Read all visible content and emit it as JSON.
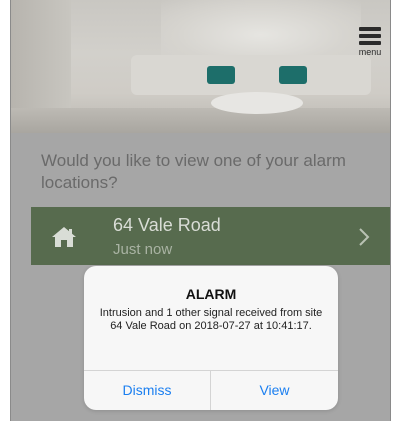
{
  "menu": {
    "label": "menu",
    "icon": "hamburger-menu-icon"
  },
  "prompt": {
    "text": "Would you like to view one of your alarm locations?"
  },
  "location": {
    "name": "64 Vale Road",
    "time": "Just now",
    "icon": "home-icon",
    "chevron": "chevron-right-icon"
  },
  "alert": {
    "title": "ALARM",
    "message": "Intrusion and 1 other signal received from site  64 Vale Road on 2018-07-27 at 10:41:17.",
    "dismiss_label": "Dismiss",
    "view_label": "View"
  },
  "colors": {
    "location_bg": "#576b4e",
    "alert_button": "#1b7ff0"
  }
}
